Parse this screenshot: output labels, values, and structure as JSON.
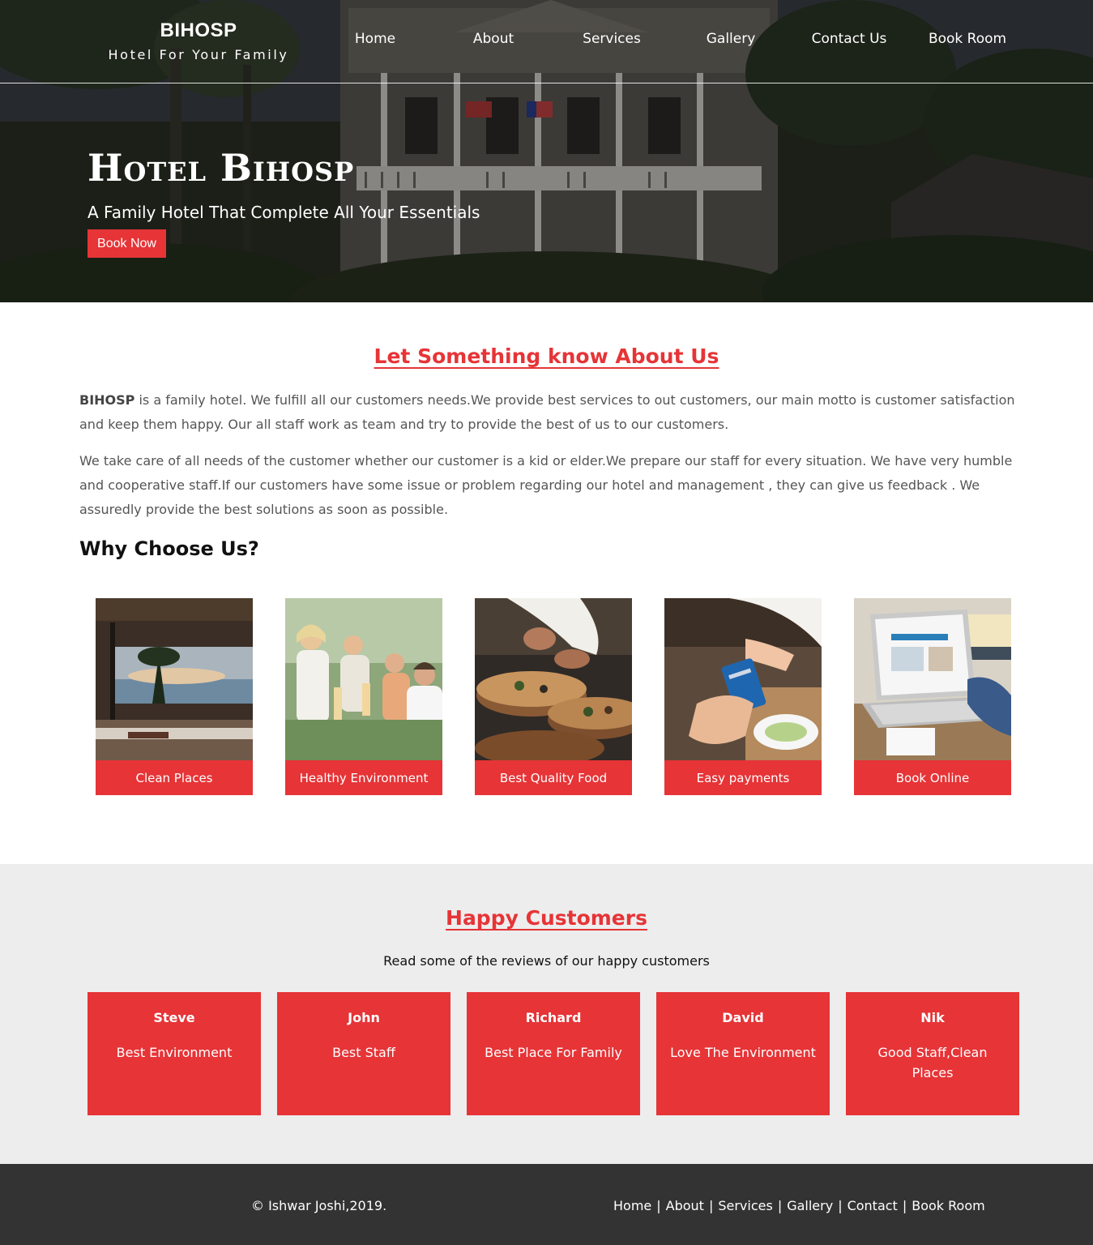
{
  "header": {
    "brand_name": "BIHOSP",
    "brand_tagline": "Hotel For Your Family",
    "nav": [
      {
        "label": "Home"
      },
      {
        "label": "About"
      },
      {
        "label": "Services"
      },
      {
        "label": "Gallery"
      },
      {
        "label": "Contact Us"
      },
      {
        "label": "Book Room"
      }
    ]
  },
  "hero": {
    "title": "Hotel Bihosp",
    "subtitle": "A Family Hotel That Complete All Your Essentials",
    "button_label": "Book Now"
  },
  "about": {
    "title": "Let Something know About Us",
    "p1_strong": "BIHOSP",
    "p1_rest": " is a family hotel. We fulfill all our customers needs.We provide best services to out customers, our main motto is customer satisfaction and keep them happy. Our all staff work as team and try to provide the best of us to our customers.",
    "p2": "We take care of all needs of the customer whether our customer is a kid or elder.We prepare our staff for every situation. We have very humble and cooperative staff.If our customers have some issue or problem regarding our hotel and management , they can give us feedback . We assuredly provide the best solutions as soon as possible.",
    "why_title": "Why Choose Us?",
    "features": [
      {
        "label": "Clean Places"
      },
      {
        "label": "Healthy Environment"
      },
      {
        "label": "Best Quality Food"
      },
      {
        "label": "Easy payments"
      },
      {
        "label": "Book Online"
      }
    ]
  },
  "customers": {
    "title": "Happy Customers",
    "subtitle": "Read some of the reviews of our happy customers",
    "reviews": [
      {
        "name": "Steve",
        "text": "Best Environment"
      },
      {
        "name": "John",
        "text": "Best Staff"
      },
      {
        "name": "Richard",
        "text": "Best Place For Family"
      },
      {
        "name": "David",
        "text": "Love The Environment"
      },
      {
        "name": "Nik",
        "text": "Good Staff,Clean Places"
      }
    ]
  },
  "footer": {
    "copyright": "© Ishwar Joshi,2019.",
    "links": [
      {
        "label": "Home"
      },
      {
        "label": "About"
      },
      {
        "label": "Services"
      },
      {
        "label": "Gallery"
      },
      {
        "label": "Contact"
      },
      {
        "label": "Book Room"
      }
    ]
  },
  "colors": {
    "accent": "#e63437",
    "customers_bg": "#ededed",
    "footer_bg": "#333333"
  }
}
